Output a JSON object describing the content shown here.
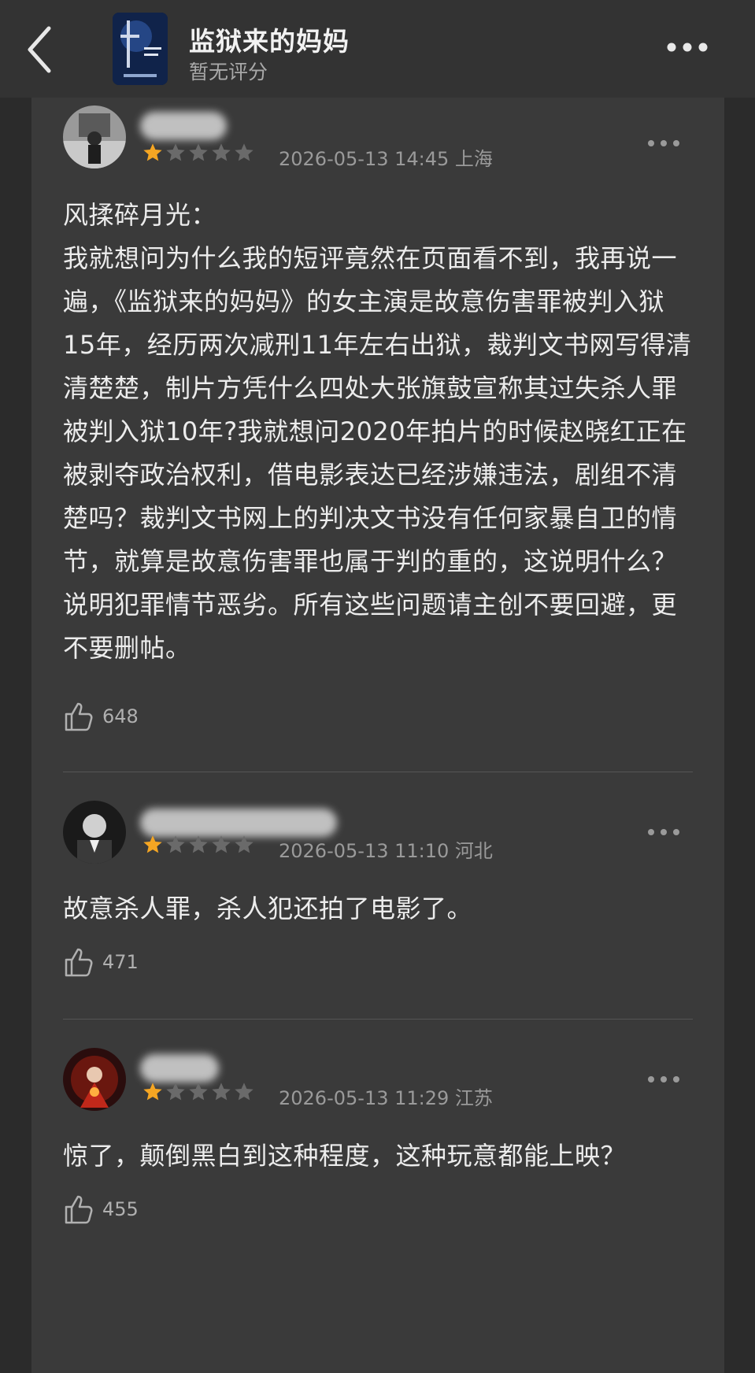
{
  "header": {
    "title": "监狱来的妈妈",
    "rating_status": "暂无评分"
  },
  "reviews": [
    {
      "stars": 1,
      "max_stars": 5,
      "datetime": "2026-05-13 14:45",
      "location": "上海",
      "content": "风揉碎月光：\n我就想问为什么我的短评竟然在页面看不到，我再说一遍，《监狱来的妈妈》的女主演是故意伤害罪被判入狱15年，经历两次减刑11年左右出狱，裁判文书网写得清清楚楚，制片方凭什么四处大张旗鼓宣称其过失杀人罪被判入狱10年?我就想问2020年拍片的时候赵晓红正在被剥夺政治权利，借电影表达已经涉嫌违法，剧组不清楚吗？裁判文书网上的判决文书没有任何家暴自卫的情节，就算是故意伤害罪也属于判的重的，这说明什么？说明犯罪情节恶劣。所有这些问题请主创不要回避，更不要删帖。",
      "likes": "648"
    },
    {
      "stars": 1,
      "max_stars": 5,
      "datetime": "2026-05-13 11:10",
      "location": "河北",
      "content": "故意杀人罪，杀人犯还拍了电影了。",
      "likes": "471"
    },
    {
      "stars": 1,
      "max_stars": 5,
      "datetime": "2026-05-13 11:29",
      "location": "江苏",
      "content": "惊了，颠倒黑白到这种程度，这种玩意都能上映？",
      "likes": "455"
    }
  ],
  "colors": {
    "star_filled": "#f5a623",
    "star_empty": "#6a6a6a",
    "background": "#2b2b2b",
    "panel": "#3a3a3a"
  }
}
